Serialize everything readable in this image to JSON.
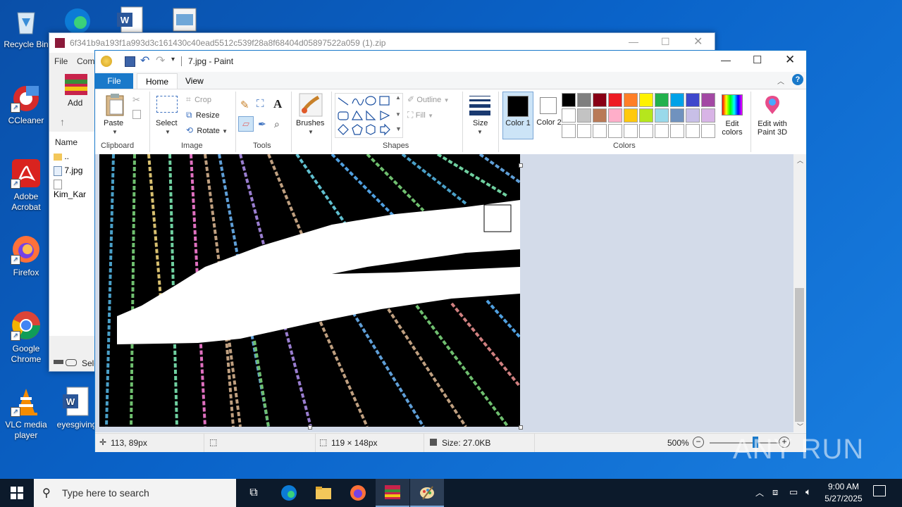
{
  "desktop": {
    "icons": [
      {
        "label": "Recycle Bin",
        "icon": "recycle-bin-icon"
      },
      {
        "label": "CCleaner",
        "icon": "ccleaner-icon"
      },
      {
        "label": "Adobe Acrobat",
        "icon": "acrobat-icon"
      },
      {
        "label": "Firefox",
        "icon": "firefox-icon"
      },
      {
        "label": "Google Chrome",
        "icon": "chrome-icon"
      },
      {
        "label": "VLC media player",
        "icon": "vlc-icon"
      },
      {
        "label": "eyesgiving",
        "icon": "word-doc-icon"
      }
    ]
  },
  "winrar": {
    "title": "6f341b9a193f1a993d3c161430c40ead5512c539f28a8f68404d05897522a059 (1).zip",
    "menu": [
      "File",
      "Com"
    ],
    "add_label": "Add",
    "name_header": "Name",
    "files": [
      "..",
      "7.jpg",
      "Kim_Kar"
    ],
    "status_text": "Sele"
  },
  "paint": {
    "title": "7.jpg - Paint",
    "tabs": {
      "file": "File",
      "home": "Home",
      "view": "View"
    },
    "clipboard": {
      "paste": "Paste",
      "label": "Clipboard"
    },
    "image": {
      "select": "Select",
      "crop": "Crop",
      "resize": "Resize",
      "rotate": "Rotate",
      "label": "Image"
    },
    "tools": {
      "label": "Tools"
    },
    "brushes": {
      "label": "Brushes"
    },
    "shapes": {
      "outline": "Outline",
      "fill": "Fill",
      "label": "Shapes"
    },
    "size": {
      "label": "Size"
    },
    "colors": {
      "color1": "Color 1",
      "color2": "Color 2",
      "edit": "Edit colors",
      "edit3d": "Edit with Paint 3D",
      "label": "Colors",
      "color1_value": "#000000",
      "color2_value": "#ffffff",
      "palette": [
        "#000000",
        "#7f7f7f",
        "#880015",
        "#ed1c24",
        "#ff7f27",
        "#fff200",
        "#22b14c",
        "#00a2e8",
        "#3f48cc",
        "#a349a4",
        "#ffffff",
        "#c3c3c3",
        "#b97a57",
        "#ffaec9",
        "#ffc90e",
        "#b5e61d",
        "#99d9ea",
        "#7092be",
        "#c8bfe7",
        "#d8b4e6"
      ]
    },
    "status": {
      "cursor": "113, 89px",
      "dimensions": "119 × 148px",
      "size": "Size: 27.0KB",
      "zoom": "500%"
    }
  },
  "taskbar": {
    "search_placeholder": "Type here to search",
    "time": "9:00 AM",
    "date": "5/27/2025"
  },
  "watermark": "ANY RUN"
}
